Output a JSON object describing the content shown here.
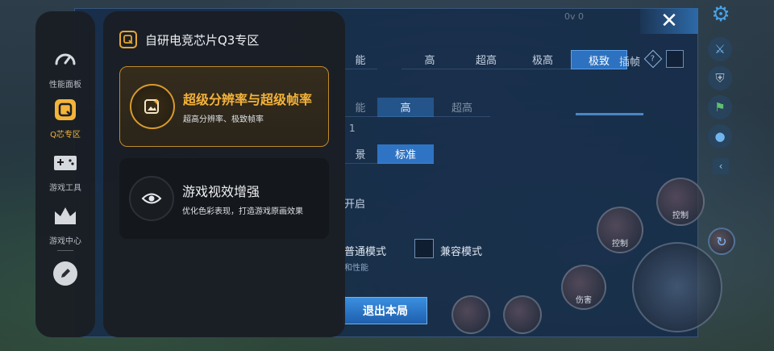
{
  "assistant": {
    "sidebar": {
      "items": [
        {
          "label": "性能面板",
          "icon": "speedometer-icon"
        },
        {
          "label": "Q芯专区",
          "icon": "q-chip-icon"
        },
        {
          "label": "游戏工具",
          "icon": "gamepad-icon"
        },
        {
          "label": "游戏中心",
          "icon": "crown-icon"
        }
      ],
      "edit_icon": "pencil-icon"
    },
    "panel": {
      "title": "自研电竞芯片Q3专区",
      "cards": [
        {
          "title": "超级分辨率与超级帧率",
          "subtitle": "超高分辨率、极致帧率",
          "icon": "super-resolution-icon",
          "selected": true
        },
        {
          "title": "游戏视效增强",
          "subtitle": "优化色彩表现，打造游戏原画效果",
          "icon": "eye-icon",
          "selected": false
        }
      ]
    }
  },
  "game_settings": {
    "status": "0v 0",
    "frame_rate_row": [
      "能",
      "高",
      "超高",
      "极高",
      "极致"
    ],
    "frame_rate_selected": "极致",
    "frame_interp_label": "插帧",
    "resolution_row": [
      "能",
      "高",
      "超高"
    ],
    "resolution_selected": "高",
    "mode_row": [
      "景",
      "标准"
    ],
    "mode_selected": "标准",
    "dim_value": "1",
    "on_label": "开启",
    "normal_mode": "普通模式",
    "compat_mode": "兼容模式",
    "perf_note": "和性能",
    "exit_button": "退出本局"
  },
  "hud": {
    "skill_control_1": "控制",
    "skill_control_2": "控制",
    "skill_hurt": "伤害"
  },
  "colors": {
    "accent_gold": "#f4b23a",
    "game_blue": "#2d72c0",
    "overlay_bg": "#1a1e24"
  }
}
